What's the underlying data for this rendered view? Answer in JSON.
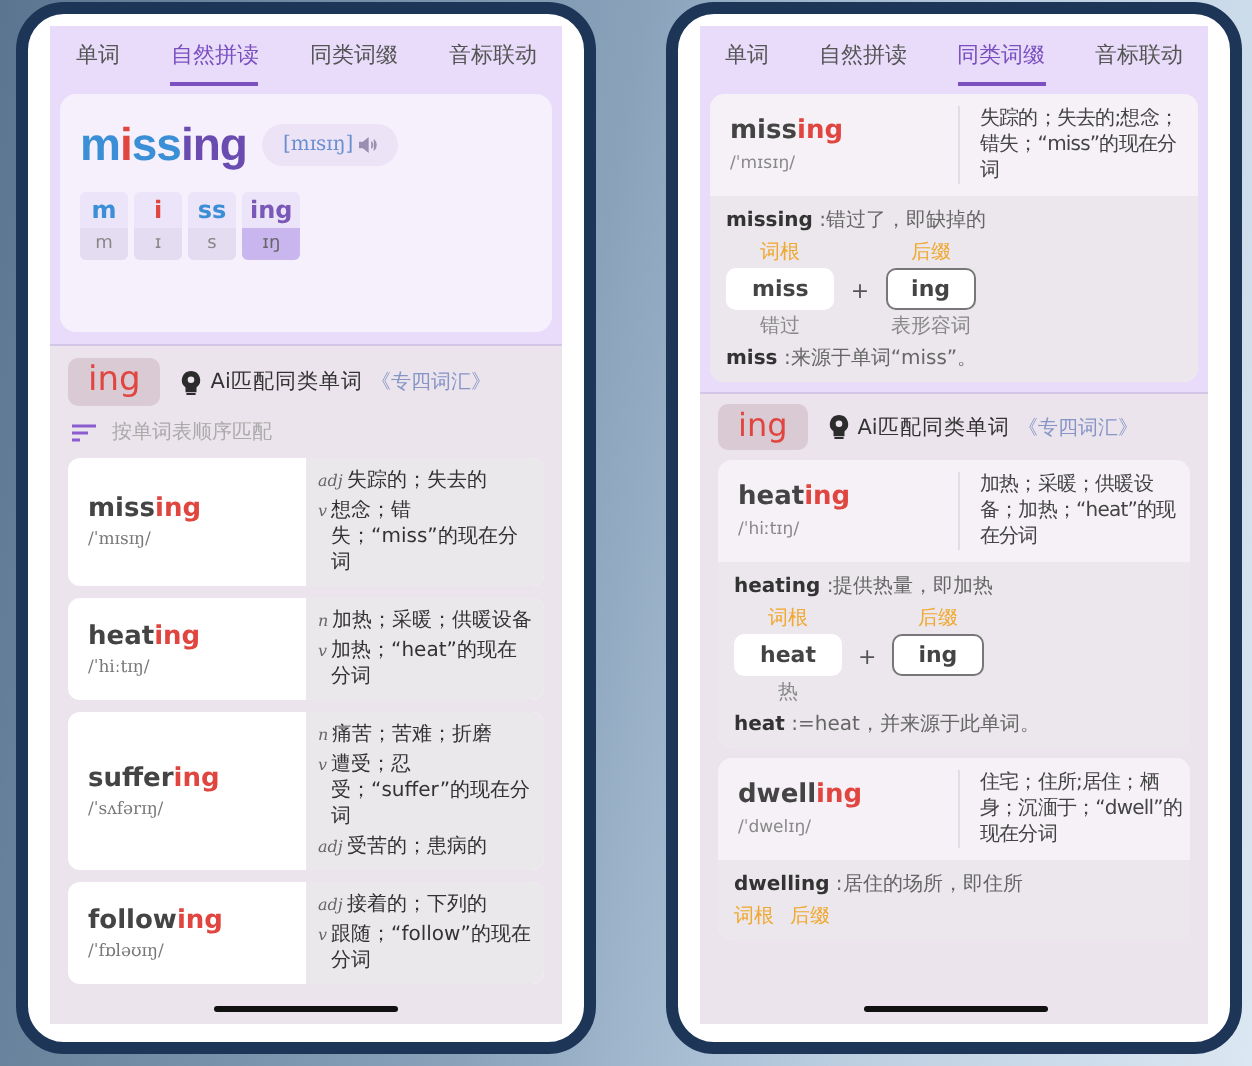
{
  "phones": [
    {
      "kind": "phonics",
      "tabs": [
        {
          "label": "单词",
          "selected": false
        },
        {
          "label": "自然拼读",
          "selected": true
        },
        {
          "label": "同类词缀",
          "selected": false
        },
        {
          "label": "音标联动",
          "selected": false
        }
      ],
      "phonics_card": {
        "word_parts": [
          {
            "text": "m",
            "color": "#3b8fd6"
          },
          {
            "text": "i",
            "color": "#e0463f"
          },
          {
            "text": "ss",
            "color": "#3b8fd6"
          },
          {
            "text": "ing",
            "color": "#6a4bb0"
          }
        ],
        "phonetic": "[mɪsɪŋ]",
        "tiles": [
          {
            "letters": "m",
            "sound": "m",
            "color": "#3b8fd6",
            "selected": false
          },
          {
            "letters": "i",
            "sound": "ɪ",
            "color": "#e0463f",
            "selected": false
          },
          {
            "letters": "ss",
            "sound": "s",
            "color": "#3b8fd6",
            "selected": false
          },
          {
            "letters": "ing",
            "sound": "ɪŋ",
            "color": "#7a58b8",
            "selected": true
          }
        ]
      },
      "suffix_bar": {
        "suffix": "ing",
        "ai_label": "Ai匹配同类单词",
        "book": "《专四词汇》"
      },
      "sort_label": "按单词表顺序匹配",
      "words": [
        {
          "stem": "miss",
          "suffix": "ing",
          "phonetic": "/ˈmɪsɪŋ/",
          "definitions": [
            {
              "pos": "adj",
              "text": "失踪的；失去的"
            },
            {
              "pos": "v",
              "text": "想念；错失；“miss”的现在分词"
            }
          ]
        },
        {
          "stem": "heat",
          "suffix": "ing",
          "phonetic": "/ˈhiːtɪŋ/",
          "definitions": [
            {
              "pos": "n",
              "text": "加热；采暖；供暖设备"
            },
            {
              "pos": "v",
              "text": "加热；“heat”的现在分词"
            }
          ]
        },
        {
          "stem": "suffer",
          "suffix": "ing",
          "phonetic": "/ˈsʌfərɪŋ/",
          "definitions": [
            {
              "pos": "n",
              "text": "痛苦；苦难；折磨"
            },
            {
              "pos": "v",
              "text": "遭受；忍受；“suffer”的现在分词"
            },
            {
              "pos": "adj",
              "text": "受苦的；患病的"
            }
          ]
        },
        {
          "stem": "follow",
          "suffix": "ing",
          "phonetic": "/ˈfɒləʊɪŋ/",
          "definitions": [
            {
              "pos": "adj",
              "text": "接着的；下列的"
            },
            {
              "pos": "v",
              "text": "跟随；“follow”的现在分词"
            }
          ]
        }
      ]
    },
    {
      "kind": "affix",
      "tabs": [
        {
          "label": "单词",
          "selected": false
        },
        {
          "label": "自然拼读",
          "selected": false
        },
        {
          "label": "同类词缀",
          "selected": true
        },
        {
          "label": "音标联动",
          "selected": false
        }
      ],
      "featured": {
        "stem": "miss",
        "suffix": "ing",
        "phonetic": "/ˈmɪsɪŋ/",
        "meaning": "失踪的；失去的;想念；错失；“miss”的现在分词",
        "analysis": "**missing** :错过了，即缺掉的",
        "joiner": "+",
        "morphemes": [
          {
            "kind": "root",
            "label": "词根",
            "text": "miss",
            "gloss": "错过"
          },
          {
            "kind": "suffix",
            "label": "后缀",
            "text": "ing",
            "gloss": "表形容词"
          }
        ],
        "origin": "**miss** :来源于单词“miss”。"
      },
      "suffix_bar": {
        "suffix": "ing",
        "ai_label": "Ai匹配同类单词",
        "book": "《专四词汇》"
      },
      "entries": [
        {
          "stem": "heat",
          "suffix": "ing",
          "phonetic": "/ˈhiːtɪŋ/",
          "meaning": "加热；采暖；供暖设备；加热；“heat”的现在分词",
          "analysis": "**heating** :提供热量，即加热",
          "joiner": "+",
          "morphemes": [
            {
              "kind": "root",
              "label": "词根",
              "text": "heat",
              "gloss": "热"
            },
            {
              "kind": "suffix",
              "label": "后缀",
              "text": "ing"
            }
          ],
          "origin": "**heat** :=heat，并来源于此单词。"
        },
        {
          "stem": "dwell",
          "suffix": "ing",
          "phonetic": "/ˈdwelɪŋ/",
          "meaning": "住宅；住所;居住；栖身；沉湎于；“dwell”的现在分词",
          "analysis": "**dwelling** :居住的场所，即住所",
          "morphemes": [
            {
              "label": "词根"
            },
            {
              "label": "后缀"
            }
          ]
        }
      ]
    }
  ]
}
